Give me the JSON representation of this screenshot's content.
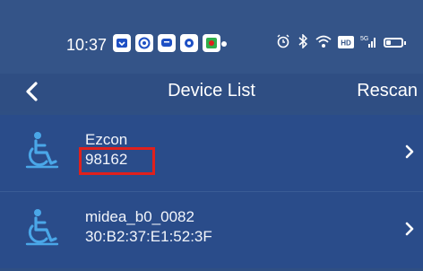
{
  "status_bar": {
    "time": "10:37",
    "icons": [
      "notification-app-icon",
      "gallery-app-icon",
      "message-app-icon",
      "camera-app-icon",
      "game-app-icon"
    ],
    "system_icons": [
      "alarm-icon",
      "bluetooth-icon",
      "wifi-icon",
      "hd-icon",
      "signal-5g-icon",
      "battery-icon"
    ],
    "hd_label": "HD",
    "signal_label": "5G"
  },
  "nav": {
    "title": "Device List",
    "rescan_label": "Rescan"
  },
  "devices": [
    {
      "name": "Ezcon",
      "id": "98162",
      "highlighted": true
    },
    {
      "name": "midea_b0_0082",
      "id": "30:B2:37:E1:52:3F",
      "highlighted": false
    }
  ],
  "colors": {
    "background": "#2f4f83",
    "list_item": "#2a4c8a",
    "icon_blue": "#4aa7e8",
    "highlight": "#e0201c"
  }
}
